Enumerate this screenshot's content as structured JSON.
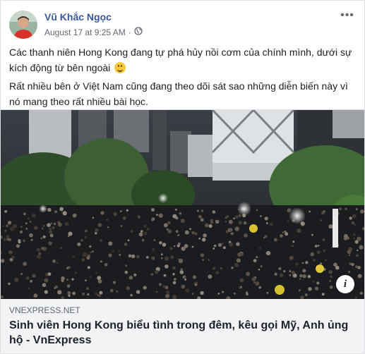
{
  "post": {
    "author": "Vũ Khắc Ngọc",
    "timestamp": "August 17 at 9:25 AM",
    "separator": "·",
    "privacy_icon": "globe-icon",
    "more_label": "•••",
    "paragraphs": [
      "Các thanh niên Hong Kong đang tự phá hủy nồi cơm của chính mình, dưới sự kích động từ bên ngoài",
      "Rất nhiều bên ở Việt Nam cũng đang theo dõi sát sao những diễn biến này vì nó mang theo rất nhiều bài học."
    ],
    "emoji": "smiling-face-icon"
  },
  "link": {
    "domain": "VNEXPRESS.NET",
    "title": "Sinh viên Hong Kong biểu tình trong đêm, kêu gọi Mỹ, Anh ủng hộ - VnExpress",
    "info_label": "i"
  },
  "colors": {
    "author": "#385898",
    "meta": "#616770",
    "text": "#1c1e21",
    "link_bg": "#f2f3f5"
  }
}
